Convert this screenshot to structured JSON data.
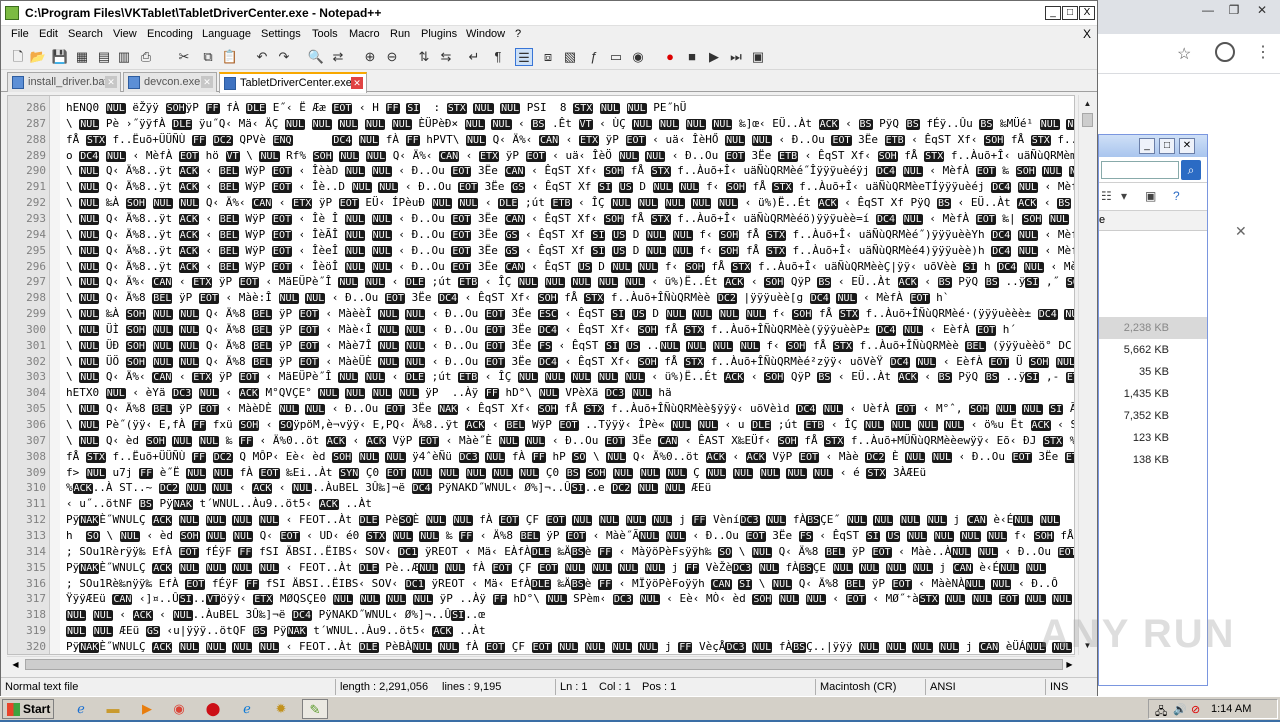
{
  "window": {
    "title": "C:\\Program Files\\VKTablet\\TabletDriverCenter.exe - Notepad++",
    "buttons": [
      "_",
      "□",
      "X"
    ]
  },
  "menu": {
    "items": [
      "File",
      "Edit",
      "Search",
      "View",
      "Encoding",
      "Language",
      "Settings",
      "Tools",
      "Macro",
      "Run",
      "Plugins",
      "Window",
      "?"
    ],
    "close": "X"
  },
  "tabs": [
    {
      "label": "install_driver.bat",
      "active": false
    },
    {
      "label": "devcon.exe",
      "active": false
    },
    {
      "label": "TabletDriverCenter.exe",
      "active": true
    }
  ],
  "editor": {
    "lines": [
      {
        "n": "286",
        "t": "hENQ0 NUL ëŽÿÿ SOHÿP FF fÀ DLE E˝‹ Ë Ææ EOT ‹ H FF SI  : STX NUL NUL PSI  8 STX NUL NUL PE˝hÜ"
      },
      {
        "n": "287",
        "t": "\\ NUL Pè ›˝ÿÿfÀ DLE ÿu˝Q‹ Mä‹ ÄÇ NUL NUL NUL NUL NUL ÈÜPèÐ× NUL NUL ‹ BS .Êt VT ‹ ÙÇ NUL NUL NUL NUL ‰]œ‹ EÜ..Àt ACK ‹ BS PÿQ BS fÉÿ..Ûu BS ‰MÜé¹ NUL NUL h"
      },
      {
        "n": "288",
        "t": "fÅ STX f..Ëuõ+ÜÜÑÙ FF DC2 QPVè ENQ      DC4 NUL fÀ FF hPVT\\ NUL Q‹ Ä%‹ CAN ‹ ETX ÿP EOT ‹ uä‹ ÎèHŐ NUL NUL ‹ Ð..Ou EOT 3Ëe ETB ‹ ÊqST Xf‹ SOH fÅ STX f..Àuõ+Î‹ uäÑ"
      },
      {
        "n": "289",
        "t": "o DC4 NUL ‹ MèfÀ EOT hö VT \\ NUL Rf% SOH NUL NUL Q‹ Ä%‹ CAN ‹ ETX ÿP EOT ‹ uä‹ ÎèÖ NUL NUL ‹ Ð..Ou EOT 3Ëe ETB ‹ ÊqST Xf‹ SOH fÅ STX f..Àuõ+Î‹ uäÑùQRMèmfÿÿÿuèè¶ŋD"
      },
      {
        "n": "290",
        "t": "\\ NUL Q‹ Ä%8..ÿt ACK ‹ BEL WÿP EOT ‹ ÎèàD NUL NUL ‹ Ð..Ou EOT 3Ëe CAN ‹ ÊqST Xf‹ SOH fÅ STX f..Àuõ+Î‹ uäÑùQRMèé˝Îÿÿÿuèéÿj DC4 NUL ‹ MèfÀ EOT ‰ SOH NUL NUL h FF"
      },
      {
        "n": "291",
        "t": "\\ NUL Q‹ Ä%8..ÿt ACK ‹ BEL WÿP EOT ‹ Îè..D NUL NUL ‹ Ð..Ou EOT 3Ëe GS ‹ ÊqST Xf SI US D NUL NUL f‹ SOH fÅ STX f..Àuõ+Î‹ uäÑùQRMèeTÍÿÿÿuèéj DC4 NUL ‹ MèfÀ EOT ‰ SO"
      },
      {
        "n": "292",
        "t": "\\ NUL ‰À SOH NUL NUL Q‹ Ä%‹ CAN ‹ ETX ÿP EOT EÜ‹ ÍPèuÐ NUL NUL ‹ DLE ;út ETB ‹ ÎÇ NUL NUL NUL NUL NUL ‹ ü%)Ë..Ét ACK ‹ ÊqST Xf PÿQ BS ‹ EÜ..Àt ACK ‹ BS PÿQ BS h<"
      },
      {
        "n": "293",
        "t": "\\ NUL Q‹ Ä%8..ÿt ACK ‹ BEL WÿP EOT ‹ Îè Î NUL NUL ‹ Ð..Ou EOT 3Ëe CAN ‹ ÊqST Xf‹ SOH fÅ STX f..Àuõ+Î‹ uäÑùQRMèéö)ÿÿÿuèè=í DC4 NUL ‹ MèfÀ EOT ‰| SOH NUL NUL h DC"
      },
      {
        "n": "294",
        "t": "\\ NUL Q‹ Ä%8..ÿt ACK ‹ BEL WÿP EOT ‹ ÎèÃÎ NUL NUL ‹ Ð..Ou EOT 3Ëe GS ‹ ÊqST Xf SI US D NUL NUL f‹ SOH fÅ STX f..Àuõ+Î‹ uäÑùQRMèé˝)ÿÿÿuèèYh DC4 NUL ‹ MèfÀ EOT"
      },
      {
        "n": "295",
        "t": "\\ NUL Q‹ Ä%8..ÿt ACK ‹ BEL WÿP EOT ‹ ÎèeÎ NUL NUL ‹ Ð..Ou EOT 3Ëe GS ‹ ÊqST Xf SI US D NUL NUL f‹ SOH fÅ STX f..Àuõ+Î‹ uäÑùQRMèé4)ÿÿÿuèè)h DC4 NUL ‹ MèfÀ EOT ‰..f"
      },
      {
        "n": "296",
        "t": "\\ NUL Q‹ Ä%8..ÿt ACK ‹ BEL WÿP EOT ‹ ÎèöÎ NUL NUL ‹ Ð..Ou EOT 3Ëe CAN ‹ ÊqST US D NUL NUL f‹ SOH fÅ STX f..Àuõ+Î‹ uäÑùQRMèèÇ|ÿÿ‹ uõVèè SI h DC4 NUL ‹ MèfÀ EOT ‰ SOH"
      },
      {
        "n": "297",
        "t": "\\ NUL Q‹ Ä%‹ CAN ‹ ETX ÿP EOT ‹ MäEÜPè˝Î NUL NUL ‹ DLE ;út ETB ‹ ÎÇ NUL NUL NUL NUL NUL ‹ ü%)Ë..Ét ACK ‹ SOH QÿP BS ‹ EÜ..Àt ACK ‹ BS PÿQ BS ..ÿSI ‚˝ SOH NUL NUL hH"
      },
      {
        "n": "298",
        "t": "\\ NUL Q‹ Ä%8 BEL ÿP EOT ‹ Màè:Î NUL NUL ‹ Ð..Ou EOT 3Ëe DC4 ‹ ÊqST Xf‹ SOH fÅ STX f..Àuõ+ÎÑùQRMèè DC2 |ÿÿÿuèè[g DC4 NUL ‹ MèfÀ EOT h`"
      },
      {
        "n": "299",
        "t": "\\ NUL ‰À SOH NUL NUL Q‹ Ä%8 BEL ÿP EOT ‹ MàèèÎ NUL NUL ‹ Ð..Ou EOT 3Ëe ESC ‹ ÊqST SI US D NUL NUL NUL NUL f‹ SOH fÅ STX f..Àuõ+ÎÑùQRMèé·(ÿÿÿuèèè± DC4 NUL"
      },
      {
        "n": "300",
        "t": "\\ NUL ÜÌ SOH NUL NUL Q‹ Ä%8 BEL ÿP EOT ‹ Màè‹Î NUL NUL ‹ Ð..Ou EOT 3Ëe DC4 ‹ ÊqST Xf‹ SOH fÅ STX f..Àuõ+ÎÑùQRMèè(ÿÿÿuèèP± DC4 NUL ‹ EèfÀ EOT h´"
      },
      {
        "n": "301",
        "t": "\\ NUL ÜÐ SOH NUL NUL Q‹ Ä%8 BEL ÿP EOT ‹ Màè7Î NUL NUL ‹ Ð..Ou EOT 3Ëe FS ‹ ÊqST SI US ..NUL NUL NUL NUL f‹ SOH fÅ STX f..Àuõ+ÎÑùQRMèè BEL (ÿÿÿuèèö° DC"
      },
      {
        "n": "302",
        "t": "\\ NUL ÜÖ SOH NUL NUL Q‹ Ä%8 BEL ÿP EOT ‹ MàèÜÈ NUL NUL ‹ Ð..Ou EOT 3Ëe DC4 ‹ ÊqST Xf‹ SOH fÅ STX f..Àuõ+ÎÑùQRMèé²zÿÿ‹ uõVèŸ DC4 NUL ‹ EèfÀ EOT Ü SOH NUL"
      },
      {
        "n": "303",
        "t": "\\ NUL Q‹ Ä%‹ CAN ‹ ETX ÿP EOT ‹ MäEÜPè˝Î NUL NUL ‹ DLE ;út ETB ‹ ÎÇ NUL NUL NUL NUL NUL ‹ ü%)Ë..Ét ACK ‹ SOH QÿP BS ‹ EÜ..Àt ACK ‹ BS PÿQ BS ..ÿSI ‚- ETB NUL NUL EÜ"
      },
      {
        "n": "304",
        "t": "hETX0 NUL ‹ èYä DC3 NUL ‹ ACK M°QVÇE° NUL NUL NUL NUL ÿP  ..Àÿ FF hD°\\ NUL VPèXä DC3 NUL hä"
      },
      {
        "n": "305",
        "t": "\\ NUL Q‹ Ä%8 BEL ÿP EOT ‹ MàèDÈ NUL NUL ‹ Ð..Ou EOT 3Ëe NAK ‹ ÊqST Xf‹ SOH fÅ STX f..Àuõ+ÎÑùQRMèè§ÿÿÿ‹ uõVèìd DC4 NUL ‹ UèfÀ EOT ‹ M°ˆ, SOH NUL NUL SI Ã;Ä"
      },
      {
        "n": "306",
        "t": "\\ NUL Pè˝(ÿÿ‹ E‚fÀ FF fxü SOH ‹ SOÿpöM‚è¬vÿÿ‹ E‚PQ‹ Ä%8..ÿt ACK ‹ BEL WÿP EOT ..Tÿÿÿ‹ ÎPè« NUL NUL ‹ u DLE ;út ETB ‹ ÎÇ NUL NUL NUL NUL ‹ ö%u Ët ACK ‹ S"
      },
      {
        "n": "307",
        "t": "\\ NUL Q‹ èd SOH NUL NUL ‰ FF ‹ Ä%0..öt ACK ‹ ACK VÿP EOT ‹ Màè˝È NUL NUL ‹ Ð..Ou EOT 3Ëe CAN ‹ ÊAST X‰EÜf‹ SOH fÅ STX f..Àuõ+MÜÑùQRMèèewÿÿ‹ Eõ‹ ÐJ STX %Ü"
      },
      {
        "n": "308",
        "t": "fÅ STX f..Ëuõ+ÜÜÑÙ FF DC2 Q MÔP‹ Eè‹ èd SOH NUL NUL ÿ4ˆèÑü DC3 NUL fÀ FF hP SO \\ NUL Q‹ Ä%0..öt ACK ‹ ACK VÿP EOT ‹ Màè DC2 È NUL NUL ‹ Ð..Ou EOT 3Ëe ETB ‹ Êq ST"
      },
      {
        "n": "309",
        "t": "f> NUL u7j FF è˝Ë NUL NUL fÀ EOT ‰Ei..Àt SYN Ç0 EOT NUL NUL NUL NUL NUL Ç0 BS SOH NUL NUL NUL Ç NUL NUL NUL NUL NUL ‹ é STX 3ÀÆEü"
      },
      {
        "n": "310",
        "t": "%ACK..À ST..~ DC2 NUL NUL ‹ ACK ‹ NUL..ÀuBEL 3Û‰]¬ë DC4 PÿNAKD˝WNUL‹ Ø%]¬..ÛSI..e DC2 NUL NUL ÆEü"
      },
      {
        "n": "311",
        "t": "‹ u˝..ötNF BS PÿNAK t´WNUL..Àu9..öt5‹ ACK ..Àt"
      },
      {
        "n": "312",
        "t": "PÿNAKÈ˝WNULÇ ACK NUL NUL NUL NUL ‹ FEOT..Àt DLE PèSOÈ NUL NUL fÀ EOT ÇF EOT NUL NUL NUL NUL j FF VèníDC3 NUL fÀBSÇE˝ NUL NUL NUL NUL j CAN è‹ÉNUL NUL"
      },
      {
        "n": "313",
        "t": "h  SO \\ NUL ‹ èd SOH NUL NUL Q‹ EOT ‹ UD‹ é0 STX NUL NUL ‰ FF ‹ Ä%8 BEL ÿP EOT ‹ Màè˝ÃNUL NUL ‹ Ð..Ou EOT 3Ëe FS ‹ ÊqST SI US NUL NUL NUL NUL f‹ SOH fÅ STX"
      },
      {
        "n": "314",
        "t": "; SOu1Rèrÿÿ‰ EfÀ EOT fÉÿF FF fSI ÄBSI..ËIBS‹ SOV‹ DC1 ÿREOT ‹ Mä‹ EÀfÀDLE ‰ÄBSè FF ‹ MàÿöPèFsÿÿh‰ SO \\ NUL Q‹ Ä%8 BEL ÿP EOT ‹ Màè..ÀNUL NUL ‹ Ð..Ou EOT"
      },
      {
        "n": "315",
        "t": "PÿNAKÈ˝WNULÇ ACK NUL NUL NUL NUL ‹ FEOT..Àt DLE Pè..ÆNUL NUL fÀ EOT ÇF EOT NUL NUL NUL NUL j FF VèŽèDC3 NUL fÀBSÇE NUL NUL NUL NUL j CAN è‹ÉNUL NUL"
      },
      {
        "n": "316",
        "t": "; SOu1Rè‰nÿÿ‰ EfÀ EOT fÉÿF FF fSI ÄBSI..ËIBS‹ SOV‹ DC1 ÿREOT ‹ Mä‹ EfÀDLE ‰ÄBSè FF ‹ MÏÿöPèFoÿÿh CAN SI \\ NUL Q‹ Ä%8 BEL ÿP EOT ‹ MàèNÀNUL NUL ‹ Ð..Ô"
      },
      {
        "n": "317",
        "t": "ŸÿÿÆEü CAN ‹]¤..ÛSI..VTöÿÿ‹ ETX MØQSÇE0 NUL NUL NUL NUL ÿP ..Àÿ FF hD°\\ NUL SPèm‹ DC3 NUL ‹ Eè‹ MÒ‹ èd SOH NUL NUL ‹ EOT ‹ MØ˝⁺àSTX NUL NUL EOT NUL NUL NUL N"
      },
      {
        "n": "318",
        "t": "NUL NUL ‹ ACK ‹ NUL..ÀuBEL 3Û‰]¬ë DC4 PÿNAKD˝WNUL‹ Ø%]¬..ÛSI..œ"
      },
      {
        "n": "319",
        "t": "NUL NUL ÆEü GS ‹u|ÿÿÿ..ötQF BS PÿNAK t´WNUL..Àu9..öt5‹ ACK ..Àt"
      },
      {
        "n": "320",
        "t": "PÿNAKÈ˝WNULÇ ACK NUL NUL NUL NUL ‹ FEOT..Àt DLE PèBÀNUL NUL fÀ EOT ÇF EOT NUL NUL NUL NUL j FF VèçÅDC3 NUL fÀBSÇ..|ÿÿÿ NUL NUL NUL NUL j CAN èÜÁNUL NUL"
      }
    ]
  },
  "statusbar": {
    "filetype": "Normal text file",
    "length": "length : 2,291,056",
    "lines": "lines : 9,195",
    "ln": "Ln : 1",
    "col": "Col : 1",
    "pos": "Pos : 1",
    "eol": "Macintosh (CR)",
    "encoding": "ANSI",
    "mode": "INS"
  },
  "explorer": {
    "column": "e",
    "sizes": [
      "2,238 KB",
      "5,662 KB",
      "35 KB",
      "1,435 KB",
      "7,352 KB",
      "123 KB",
      "138 KB"
    ]
  },
  "taskbar": {
    "start_label": "Start",
    "clock": "1:14 AM"
  },
  "watermark": "ANY RUN"
}
